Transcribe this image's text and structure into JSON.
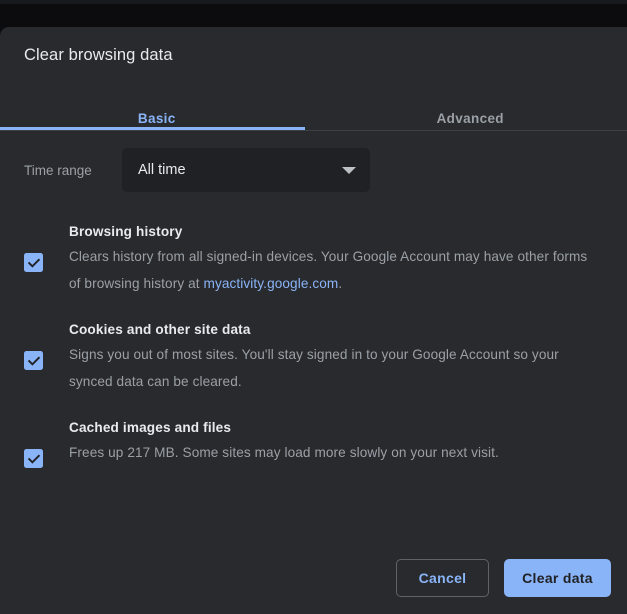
{
  "window": {
    "backdrop_color": "#0c0c0e",
    "dialog_background": "#292a2d",
    "accent_color": "#8ab4f8"
  },
  "dialog": {
    "title": "Clear browsing data"
  },
  "tabs": [
    {
      "label": "Basic",
      "active": true
    },
    {
      "label": "Advanced",
      "active": false
    }
  ],
  "time_range": {
    "label": "Time range",
    "value": "All time",
    "arrow_icon": "chevron-down-icon"
  },
  "options": [
    {
      "title": "Browsing history",
      "checked": true,
      "description_before_link": "Clears history from all signed-in devices. Your Google Account may have other forms of browsing history at ",
      "link_text": "myactivity.google.com",
      "description_after_link": "."
    },
    {
      "title": "Cookies and other site data",
      "checked": true,
      "description_before_link": "Signs you out of most sites. You'll stay signed in to your Google Account so your synced data can be cleared.",
      "link_text": "",
      "description_after_link": ""
    },
    {
      "title": "Cached images and files",
      "checked": true,
      "description_before_link": "Frees up 217 MB. Some sites may load more slowly on your next visit.",
      "link_text": "",
      "description_after_link": ""
    }
  ],
  "footer": {
    "cancel_label": "Cancel",
    "clear_data_label": "Clear data"
  }
}
